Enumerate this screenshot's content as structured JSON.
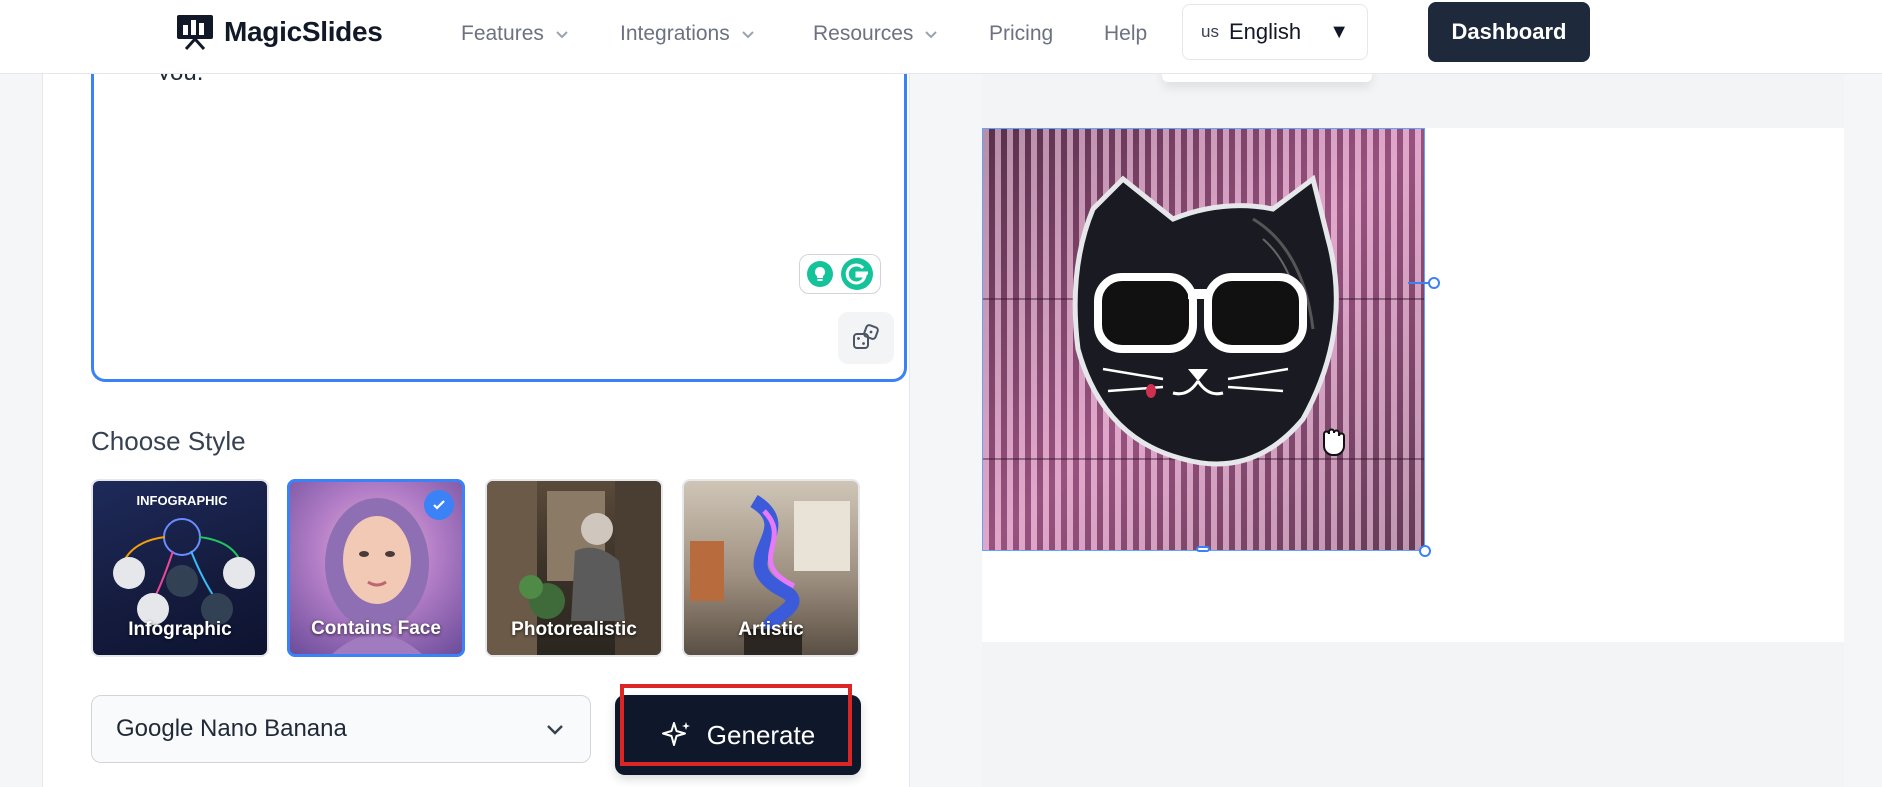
{
  "nav": {
    "logo": "MagicSlides",
    "items": [
      {
        "label": "Features",
        "dropdown": true
      },
      {
        "label": "Integrations",
        "dropdown": true
      },
      {
        "label": "Resources",
        "dropdown": true
      },
      {
        "label": "Pricing",
        "dropdown": false
      },
      {
        "label": "Help",
        "dropdown": false
      }
    ],
    "language": {
      "code": "us",
      "name": "English",
      "caret": "▼"
    },
    "dashboard": "Dashboard"
  },
  "prompt": {
    "visible_text": "you."
  },
  "styles": {
    "title": "Choose Style",
    "cards": [
      {
        "label": "Infographic",
        "heading": "INFOGRAPHIC",
        "selected": false
      },
      {
        "label": "Contains Face",
        "selected": true
      },
      {
        "label": "Photorealistic",
        "selected": false
      },
      {
        "label": "Artistic",
        "selected": false
      }
    ]
  },
  "model": {
    "selected": "Google Nano Banana"
  },
  "generate": {
    "label": "Generate"
  },
  "colors": {
    "accent": "#3b82f6",
    "dark": "#0f172a",
    "highlight": "#dc2626"
  }
}
